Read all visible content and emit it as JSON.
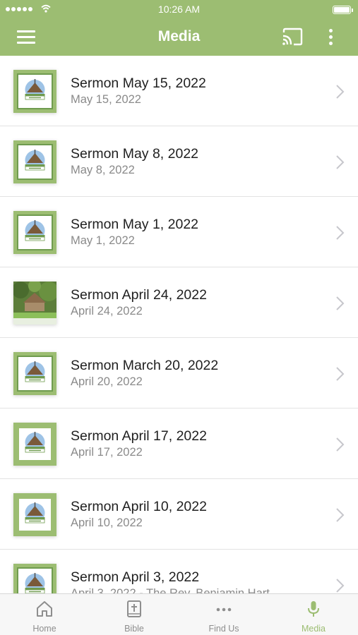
{
  "status_bar": {
    "time": "10:26 AM"
  },
  "header": {
    "title": "Media"
  },
  "items": [
    {
      "title": "Sermon May 15, 2022",
      "subtitle": "May 15, 2022",
      "thumb": "podcast-logo"
    },
    {
      "title": "Sermon May 8, 2022",
      "subtitle": "May 8, 2022",
      "thumb": "podcast-logo"
    },
    {
      "title": "Sermon May 1, 2022",
      "subtitle": "May 1, 2022",
      "thumb": "podcast-logo"
    },
    {
      "title": "Sermon April 24, 2022",
      "subtitle": "April 24, 2022",
      "thumb": "church-photo"
    },
    {
      "title": "Sermon March 20, 2022",
      "subtitle": "April 20, 2022",
      "thumb": "podcast-logo"
    },
    {
      "title": "Sermon April 17, 2022",
      "subtitle": "April 17, 2022",
      "thumb": "podcast-logo"
    },
    {
      "title": "Sermon April 10, 2022",
      "subtitle": "April 10, 2022",
      "thumb": "podcast-logo"
    },
    {
      "title": "Sermon April 3, 2022",
      "subtitle": "April 3, 2022 - The Rev. Benjamin Hart",
      "thumb": "podcast-logo"
    }
  ],
  "tabs": [
    {
      "label": "Home",
      "icon": "home-icon"
    },
    {
      "label": "Bible",
      "icon": "bible-icon"
    },
    {
      "label": "Find Us",
      "icon": "more-dots-icon"
    },
    {
      "label": "Media",
      "icon": "microphone-icon"
    }
  ],
  "colors": {
    "accent": "#9cbd72",
    "text": "#1f1f1f",
    "subtext": "#8a8a8a",
    "tab_inactive": "#8e8e8e"
  }
}
